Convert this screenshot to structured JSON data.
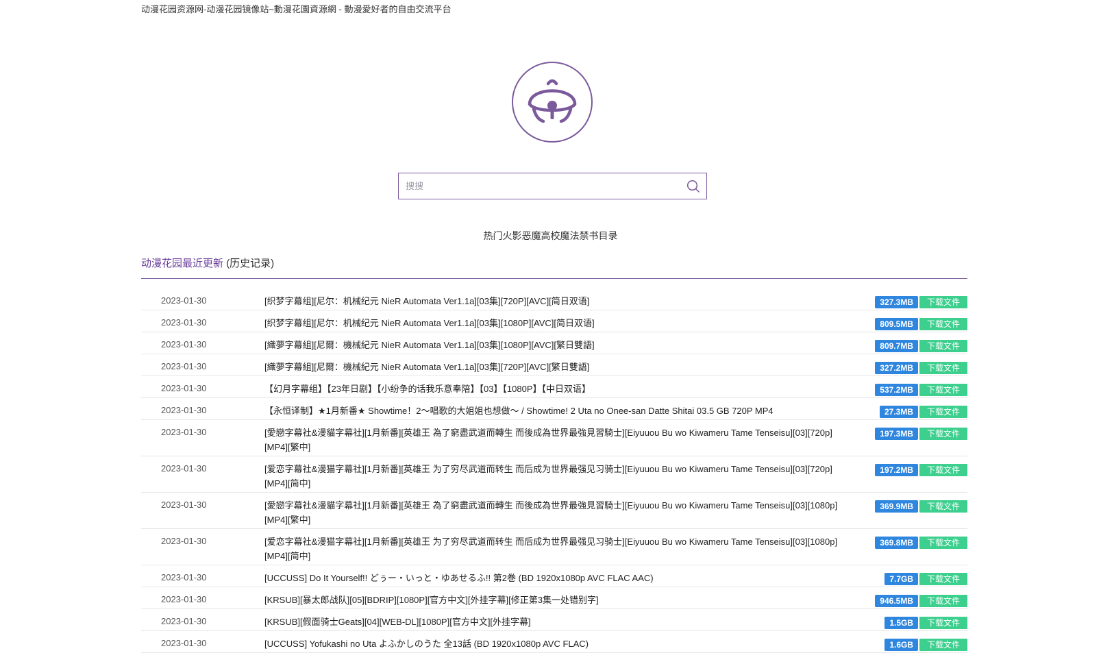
{
  "site_title": "动漫花园资源网-动漫花园镜像站~動漫花園資源網 - 動漫愛好者的自由交流平台",
  "logo": {
    "icon": "bell-icon",
    "color": "#7b5a9c"
  },
  "search": {
    "placeholder": "搜搜",
    "value": "",
    "icon": "search-icon"
  },
  "hot_label": "热门",
  "hot_links": [
    "火影",
    "恶魔高校",
    "魔法禁书目录"
  ],
  "section": {
    "title": "动漫花园最近更新",
    "history_link": "(历史记录)"
  },
  "colors": {
    "accent": "#7b5a9c",
    "size_badge": "#2e86de",
    "download_button": "#3ccf8e"
  },
  "rows": [
    {
      "date": "2023-01-30",
      "title": "[织梦字幕组][尼尔：机械纪元 NieR Automata Ver1.1a][03集][720P][AVC][简日双语]",
      "size": "327.3MB",
      "download": "下载文件"
    },
    {
      "date": "2023-01-30",
      "title": "[织梦字幕组][尼尔：机械纪元 NieR Automata Ver1.1a][03集][1080P][AVC][简日双语]",
      "size": "809.5MB",
      "download": "下载文件"
    },
    {
      "date": "2023-01-30",
      "title": "[織夢字幕組][尼爾：機械紀元 NieR Automata Ver1.1a][03集][1080P][AVC][繁日雙語]",
      "size": "809.7MB",
      "download": "下载文件"
    },
    {
      "date": "2023-01-30",
      "title": "[織夢字幕組][尼爾：機械紀元 NieR Automata Ver1.1a][03集][720P][AVC][繁日雙語]",
      "size": "327.2MB",
      "download": "下载文件"
    },
    {
      "date": "2023-01-30",
      "title": "【幻月字幕组】【23年日剧】【小纷争的话我乐意奉陪】【03】【1080P】【中日双语】",
      "size": "537.2MB",
      "download": "下载文件"
    },
    {
      "date": "2023-01-30",
      "title": "【永恒译制】★1月新番★ Showtime！2～唱歌的大姐姐也想做～ / Showtime! 2 Uta no Onee-san Datte Shitai 03.5 GB 720P MP4",
      "size": "27.3MB",
      "download": "下载文件"
    },
    {
      "date": "2023-01-30",
      "title": "[愛戀字幕社&漫貓字幕社][1月新番][英雄王 為了窮盡武道而轉生 而後成為世界最強見習騎士][Eiyuuou Bu wo Kiwameru Tame Tenseisu][03][720p][MP4][繁中]",
      "size": "197.3MB",
      "download": "下载文件"
    },
    {
      "date": "2023-01-30",
      "title": "[爱恋字幕社&漫猫字幕社][1月新番][英雄王 为了穷尽武道而转生 而后成为世界最强见习骑士][Eiyuuou Bu wo Kiwameru Tame Tenseisu][03][720p][MP4][简中]",
      "size": "197.2MB",
      "download": "下载文件"
    },
    {
      "date": "2023-01-30",
      "title": "[愛戀字幕社&漫貓字幕社][1月新番][英雄王 為了窮盡武道而轉生 而後成為世界最強見習騎士][Eiyuuou Bu wo Kiwameru Tame Tenseisu][03][1080p][MP4][繁中]",
      "size": "369.9MB",
      "download": "下载文件"
    },
    {
      "date": "2023-01-30",
      "title": "[爱恋字幕社&漫猫字幕社][1月新番][英雄王 为了穷尽武道而转生 而后成为世界最强见习骑士][Eiyuuou Bu wo Kiwameru Tame Tenseisu][03][1080p][MP4][简中]",
      "size": "369.8MB",
      "download": "下载文件"
    },
    {
      "date": "2023-01-30",
      "title": "[UCCUSS] Do It Yourself!! どぅー・いっと・ゆあせるふ!! 第2巻 (BD 1920x1080p AVC FLAC AAC)",
      "size": "7.7GB",
      "download": "下载文件"
    },
    {
      "date": "2023-01-30",
      "title": "[KRSUB][暴太郎战队][05][BDRIP][1080P][官方中文][外挂字幕][修正第3集一处错别字]",
      "size": "946.5MB",
      "download": "下载文件"
    },
    {
      "date": "2023-01-30",
      "title": "[KRSUB][假面骑士Geats][04][WEB-DL][1080P][官方中文][外挂字幕]",
      "size": "1.5GB",
      "download": "下载文件"
    },
    {
      "date": "2023-01-30",
      "title": "[UCCUSS] Yofukashi no Uta よふかしのうた 全13話 (BD 1920x1080p AVC FLAC)",
      "size": "1.6GB",
      "download": "下载文件"
    }
  ]
}
